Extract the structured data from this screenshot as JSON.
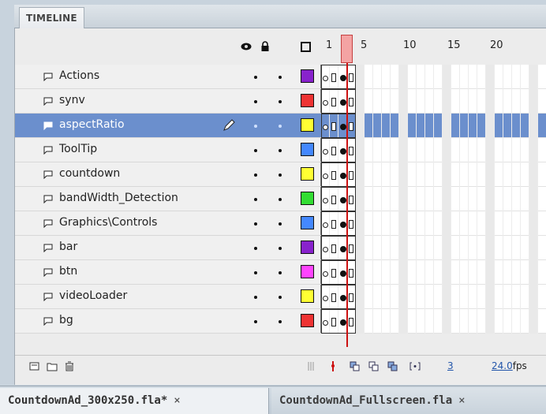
{
  "panel": {
    "title": "TIMELINE"
  },
  "ruler": {
    "marks": [
      "1",
      "5",
      "10",
      "15",
      "20"
    ]
  },
  "layers": [
    {
      "name": "Actions",
      "color": "#8822cc",
      "selected": false
    },
    {
      "name": "synv",
      "color": "#ee3333",
      "selected": false
    },
    {
      "name": "aspectRatio",
      "color": "#ffff33",
      "selected": true
    },
    {
      "name": "ToolTip",
      "color": "#4488ff",
      "selected": false
    },
    {
      "name": "countdown",
      "color": "#ffff33",
      "selected": false
    },
    {
      "name": "bandWidth_Detection",
      "color": "#33dd33",
      "selected": false
    },
    {
      "name": "Graphics\\Controls",
      "color": "#4488ff",
      "selected": false
    },
    {
      "name": "bar",
      "color": "#8822cc",
      "selected": false
    },
    {
      "name": "btn",
      "color": "#ff44ff",
      "selected": false
    },
    {
      "name": "videoLoader",
      "color": "#ffff33",
      "selected": false
    },
    {
      "name": "bg",
      "color": "#ee3333",
      "selected": false
    }
  ],
  "footer": {
    "current_frame": "3",
    "fps_value": "24.0",
    "fps_unit": "fps"
  },
  "documents": [
    {
      "name": "CountdownAd_300x250.fla*",
      "close": "×",
      "active": true
    },
    {
      "name": "CountdownAd_Fullscreen.fla",
      "close": "×",
      "active": false
    }
  ]
}
